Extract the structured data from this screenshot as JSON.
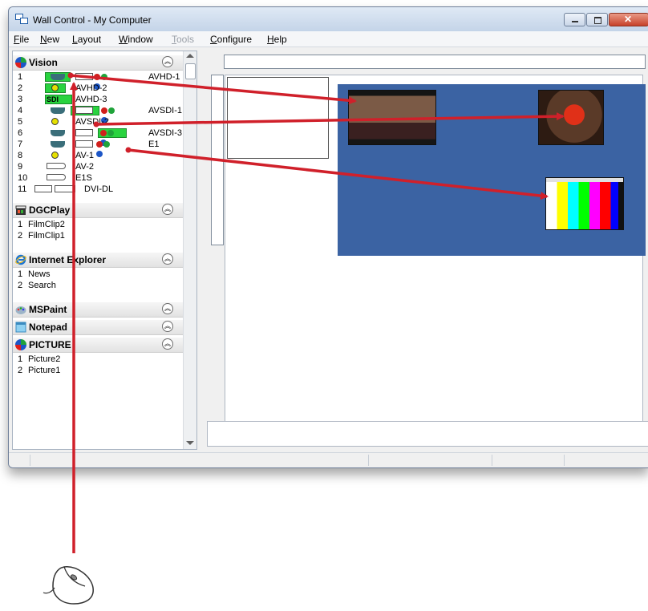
{
  "window": {
    "title": "Wall Control - My Computer",
    "controls": {
      "minimize": "minimize",
      "maximize": "maximize",
      "close": "✕"
    }
  },
  "menu": [
    "File",
    "New",
    "Layout",
    "Window",
    "Tools",
    "Configure",
    "Help"
  ],
  "menu_disabled": [
    "Tools"
  ],
  "groups": {
    "vision": {
      "name": "Vision",
      "rows": [
        {
          "num": "1",
          "label": "AVHD-1"
        },
        {
          "num": "2",
          "label": "AVHD-2"
        },
        {
          "num": "3",
          "label": "AVHD-3",
          "badge": "SDI"
        },
        {
          "num": "4",
          "label": "AVSDI-1"
        },
        {
          "num": "5",
          "label": "AVSDI-2"
        },
        {
          "num": "6",
          "label": "AVSDI-3"
        },
        {
          "num": "7",
          "label": "E1"
        },
        {
          "num": "8",
          "label": "AV-1"
        },
        {
          "num": "9",
          "label": "AV-2"
        },
        {
          "num": "10",
          "label": "E1S"
        },
        {
          "num": "11",
          "label": "DVI-DL"
        }
      ]
    },
    "dgcplay": {
      "name": "DGCPlay",
      "rows": [
        {
          "num": "1",
          "label": "FilmClip2"
        },
        {
          "num": "2",
          "label": "FilmClip1"
        }
      ]
    },
    "ie": {
      "name": "Internet Explorer",
      "rows": [
        {
          "num": "1",
          "label": "News"
        },
        {
          "num": "2",
          "label": "Search"
        }
      ]
    },
    "mspaint": {
      "name": "MSPaint"
    },
    "notepad": {
      "name": "Notepad"
    },
    "picture": {
      "name": "PICTURE",
      "rows": [
        {
          "num": "1",
          "label": "Picture2"
        },
        {
          "num": "2",
          "label": "Picture1"
        }
      ]
    }
  },
  "colors": {
    "wall_background": "#3b63a3",
    "highlight": "#29d33f",
    "arrow": "#d0202a"
  },
  "icons": {
    "vga": "vga-connector-icon",
    "dvi": "dvi-connector-icon",
    "rca": "rca-connector-icon",
    "component": "component-rgb-icon",
    "displayport": "displayport-connector-icon",
    "expand": "collapse-chevron-icon",
    "mouse": "mouse-icon"
  },
  "wall_windows": [
    {
      "name": "video-window-1",
      "content": "movie-scene"
    },
    {
      "name": "video-window-2",
      "content": "elmo"
    },
    {
      "name": "video-window-3",
      "content": "color-bars"
    }
  ]
}
